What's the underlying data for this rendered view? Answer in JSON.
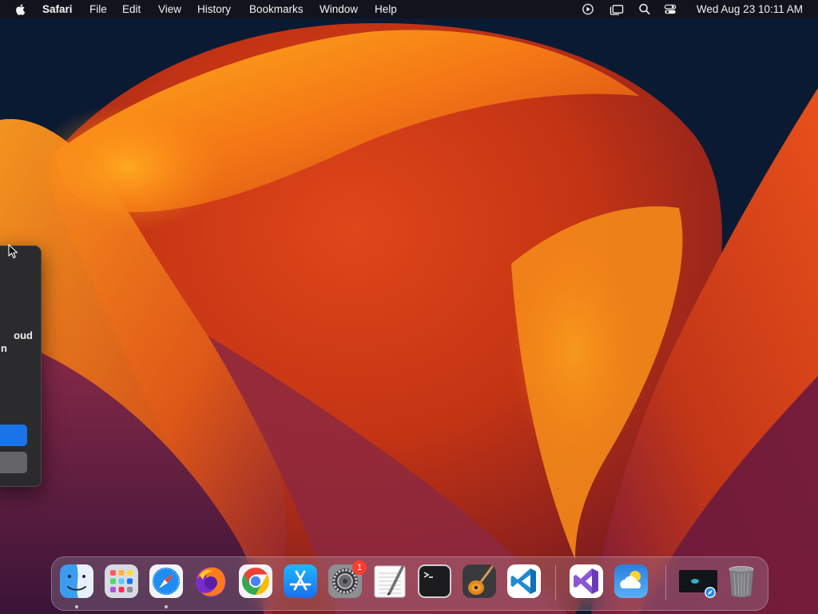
{
  "menubar": {
    "app_name": "Safari",
    "menus": [
      "File",
      "Edit",
      "View",
      "History",
      "Bookmarks",
      "Window",
      "Help"
    ],
    "clock": "Wed Aug 23  10:11 AM",
    "status_icons": [
      "screen-recording-icon",
      "stage-manager-icon",
      "spotlight-search-icon",
      "control-center-icon"
    ]
  },
  "dialog": {
    "message_line1": "oud",
    "message_line2": "n",
    "primary_button_color": "#1a73e8",
    "secondary_button_color": "#646466"
  },
  "dock": {
    "apps": [
      {
        "name": "Finder",
        "icon": "finder-icon",
        "running": true
      },
      {
        "name": "Launchpad",
        "icon": "launchpad-icon",
        "running": false
      },
      {
        "name": "Safari",
        "icon": "safari-icon",
        "running": true
      },
      {
        "name": "Firefox",
        "icon": "firefox-icon",
        "running": false
      },
      {
        "name": "Google Chrome",
        "icon": "chrome-icon",
        "running": false
      },
      {
        "name": "App Store",
        "icon": "app-store-icon",
        "running": false
      },
      {
        "name": "System Settings",
        "icon": "system-settings-icon",
        "running": false,
        "badge": "1"
      },
      {
        "name": "TextEdit",
        "icon": "textedit-icon",
        "running": false
      },
      {
        "name": "Terminal",
        "icon": "terminal-icon",
        "running": false
      },
      {
        "name": "GarageBand",
        "icon": "garageband-icon",
        "running": false
      },
      {
        "name": "Visual Studio Code",
        "icon": "vscode-icon",
        "running": false
      },
      {
        "name": "Visual Studio",
        "icon": "visual-studio-icon",
        "running": false
      },
      {
        "name": "Weather",
        "icon": "weather-icon",
        "running": false
      },
      {
        "name": "Downloads",
        "icon": "downloads-stack-icon",
        "running": false
      },
      {
        "name": "Trash",
        "icon": "trash-icon",
        "running": false
      }
    ],
    "badge_count": "1"
  },
  "colors": {
    "accent": "#1a73e8",
    "badge": "#ff3b30",
    "wallpaper_dark": "#0b1a33",
    "wallpaper_orange": "#f7821e",
    "wallpaper_purple": "#5a1a4a"
  }
}
